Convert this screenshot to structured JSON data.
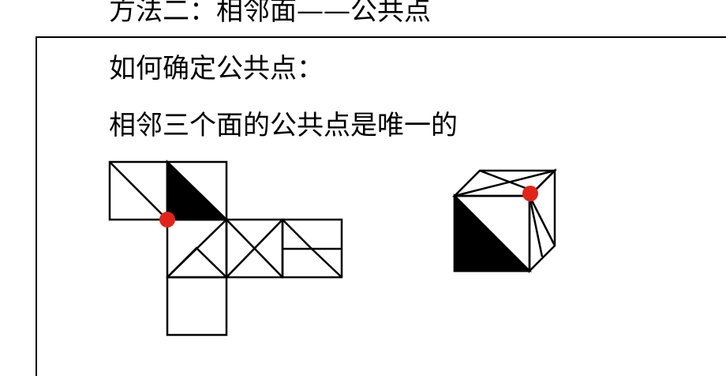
{
  "heading": "方法二：相邻面——公共点",
  "question": "如何确定公共点：",
  "answer": "相邻三个面的公共点是唯一的",
  "colors": {
    "marker": "#e0241b",
    "stroke": "#000000",
    "fill_dark": "#000000"
  }
}
